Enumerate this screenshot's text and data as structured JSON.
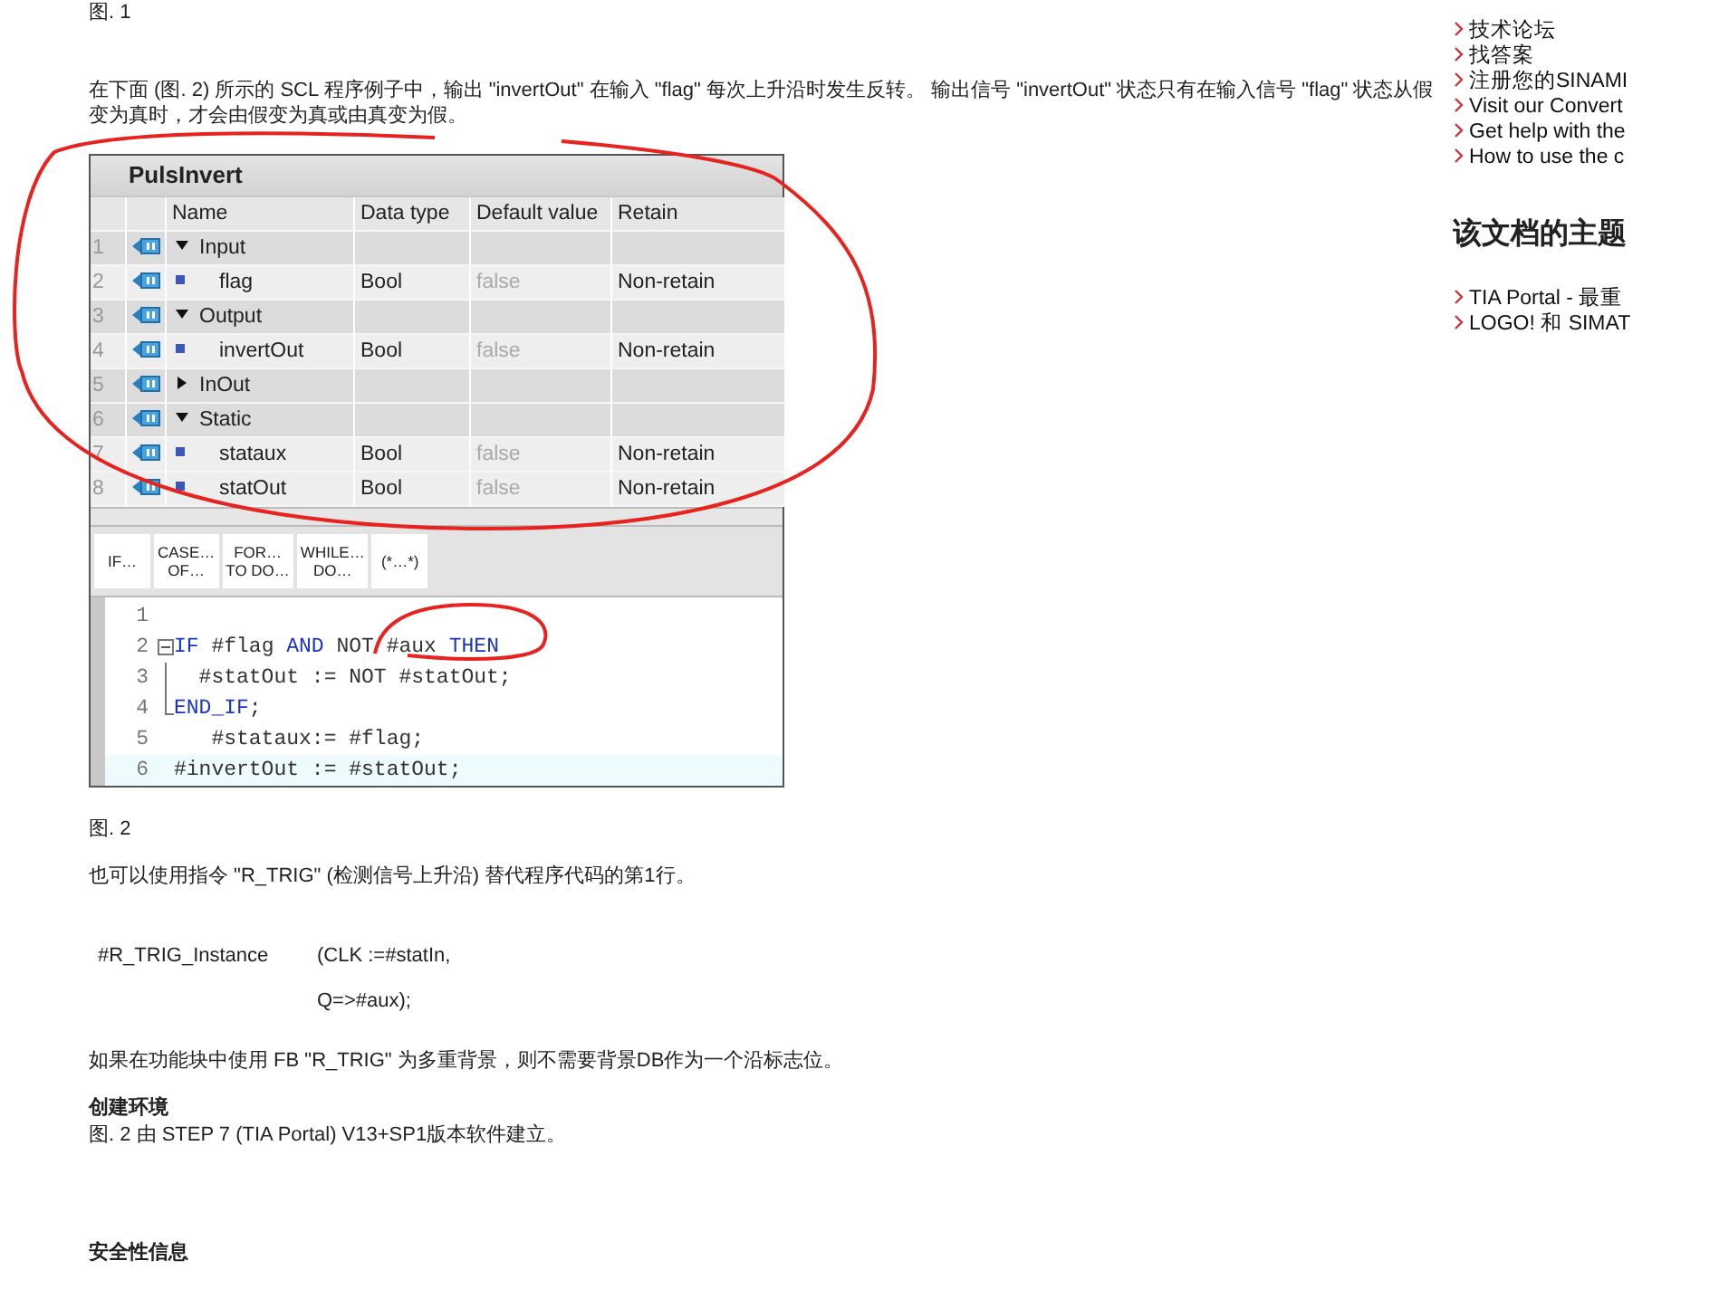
{
  "figure_caption_top": "图. 1",
  "intro": "在下面 (图. 2) 所示的 SCL 程序例子中，输出 \"invertOut\" 在输入 \"flag\" 每次上升沿时发生反转。 输出信号 \"invertOut\" 状态只有在输入信号 \"flag\" 状态从假变为真时，才会由假变为真或由真变为假。",
  "interface_table": {
    "title": "PulsInvert",
    "columns": [
      "Name",
      "Data type",
      "Default value",
      "Retain"
    ],
    "rows": [
      {
        "number": "1",
        "kind": "section",
        "expanded": true,
        "name": "Input"
      },
      {
        "number": "2",
        "kind": "variable",
        "name": "flag",
        "data_type": "Bool",
        "default_value": "false",
        "retain": "Non-retain"
      },
      {
        "number": "3",
        "kind": "section",
        "expanded": true,
        "name": "Output"
      },
      {
        "number": "4",
        "kind": "variable",
        "name": "invertOut",
        "data_type": "Bool",
        "default_value": "false",
        "retain": "Non-retain"
      },
      {
        "number": "5",
        "kind": "section",
        "expanded": false,
        "name": "InOut"
      },
      {
        "number": "6",
        "kind": "section",
        "expanded": true,
        "name": "Static"
      },
      {
        "number": "7",
        "kind": "variable",
        "name": "stataux",
        "data_type": "Bool",
        "default_value": "false",
        "retain": "Non-retain"
      },
      {
        "number": "8",
        "kind": "variable",
        "name": "statOut",
        "data_type": "Bool",
        "default_value": "false",
        "retain": "Non-retain"
      }
    ]
  },
  "instruction_buttons": [
    {
      "lines": [
        "IF…"
      ]
    },
    {
      "lines": [
        "CASE…",
        "OF…"
      ]
    },
    {
      "lines": [
        "FOR…",
        "TO DO…"
      ]
    },
    {
      "lines": [
        "WHILE…",
        "DO…"
      ]
    },
    {
      "lines": [
        "(*…*)"
      ]
    }
  ],
  "code_lines": [
    {
      "number": "1",
      "kind": "plain",
      "highlighted": false
    },
    {
      "number": "2",
      "kind": "block_start",
      "highlighted": false,
      "segments": [
        {
          "kind": "keyword",
          "text": "IF"
        },
        {
          "kind": "plain",
          "text": " #flag "
        },
        {
          "kind": "keyword",
          "text": "AND"
        },
        {
          "kind": "plain",
          "text": " NOT #aux "
        },
        {
          "kind": "keyword",
          "text": "THEN"
        }
      ]
    },
    {
      "number": "3",
      "kind": "block_body",
      "highlighted": false,
      "segments": [
        {
          "kind": "plain",
          "text": "  #statOut := NOT #statOut;"
        }
      ]
    },
    {
      "number": "4",
      "kind": "block_end",
      "highlighted": false,
      "segments": [
        {
          "kind": "keyword",
          "text": "END_IF"
        },
        {
          "kind": "plain",
          "text": ";"
        }
      ]
    },
    {
      "number": "5",
      "kind": "plain",
      "highlighted": false,
      "segments": [
        {
          "kind": "plain",
          "text": "   #stataux:= #flag;"
        }
      ]
    },
    {
      "number": "6",
      "kind": "plain",
      "highlighted": true,
      "segments": [
        {
          "kind": "plain",
          "text": "#invertOut := #statOut;"
        }
      ]
    }
  ],
  "figure_caption": "图. 2",
  "alt_text": "也可以使用指令 \"R_TRIG\" (检测信号上升沿) 替代程序代码的第1行。",
  "call_example": [
    {
      "instance": "#R_TRIG_Instance",
      "argument": "(CLK :=#statIn,"
    },
    {
      "argument": "Q=>#aux);"
    }
  ],
  "multi_instance_note": "如果在功能块中使用 FB \"R_TRIG\" 为多重背景，则不需要背景DB作为一个沿标志位。",
  "environment": {
    "heading": "创建环境",
    "text": "图. 2 由 STEP 7 (TIA Portal) V13+SP1版本软件建立。"
  },
  "security_heading": "安全性信息",
  "sidebar": {
    "links": [
      "技术论坛",
      "找答案",
      "注册您的SINAMI",
      "Visit our Convert",
      "Get help with the",
      "How to use the c"
    ],
    "topics_heading": "该文档的主题",
    "topic_links": [
      "TIA Portal - 最重",
      "LOGO! 和 SIMAT"
    ]
  }
}
